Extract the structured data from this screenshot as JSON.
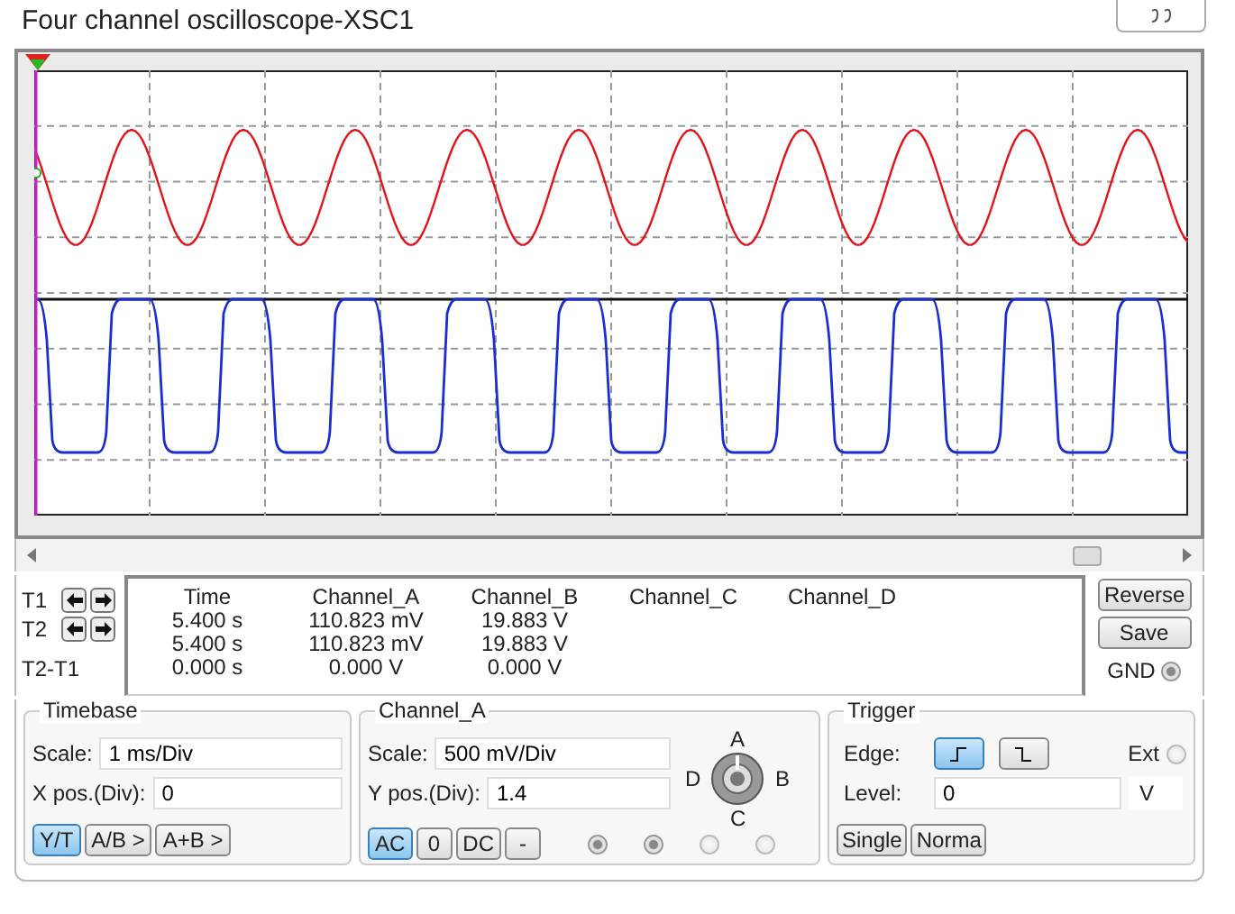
{
  "window": {
    "title": "Four channel oscilloscope-XSC1"
  },
  "readout": {
    "row_labels": [
      "T1",
      "T2",
      "T2-T1"
    ],
    "columns": [
      "Time",
      "Channel_A",
      "Channel_B",
      "Channel_C",
      "Channel_D"
    ],
    "rows": [
      [
        "5.400 s",
        "110.823 mV",
        "19.883 V"
      ],
      [
        "5.400 s",
        "110.823 mV",
        "19.883 V"
      ],
      [
        "0.000 s",
        "0.000 V",
        "0.000 V"
      ]
    ]
  },
  "side_buttons": [
    "Reverse",
    "Save"
  ],
  "gnd": {
    "label": "GND",
    "selected": true
  },
  "timebase": {
    "title": "Timebase",
    "fields": [
      {
        "label": "Scale:",
        "value": "1 ms/Div"
      },
      {
        "label": "X pos.(Div):",
        "value": "0"
      }
    ],
    "modes": [
      {
        "label": "Y/T",
        "selected": true
      },
      {
        "label": "A/B >",
        "selected": false
      },
      {
        "label": "A+B >",
        "selected": false
      }
    ]
  },
  "channel": {
    "title": "Channel_A",
    "fields": [
      {
        "label": "Scale:",
        "value": "500 mV/Div"
      },
      {
        "label": "Y pos.(Div):",
        "value": "1.4"
      }
    ],
    "knob_labels": [
      "A",
      "B",
      "C",
      "D"
    ],
    "coupling": [
      {
        "label": "AC",
        "selected": true
      },
      {
        "label": "0",
        "selected": false
      },
      {
        "label": "DC",
        "selected": false
      },
      {
        "label": "-",
        "selected": false
      }
    ],
    "radios": [
      {
        "selected": true
      },
      {
        "selected": true
      },
      {
        "selected": false
      },
      {
        "selected": false
      }
    ]
  },
  "trigger": {
    "title": "Trigger",
    "edge_label": "Edge:",
    "edges": [
      {
        "kind": "rising",
        "selected": true
      },
      {
        "kind": "falling",
        "selected": false
      }
    ],
    "ext": {
      "label": "Ext",
      "selected": false
    },
    "level_label": "Level:",
    "level_value": "0",
    "level_unit": "V",
    "modes": [
      "Single",
      "Norma"
    ]
  }
}
